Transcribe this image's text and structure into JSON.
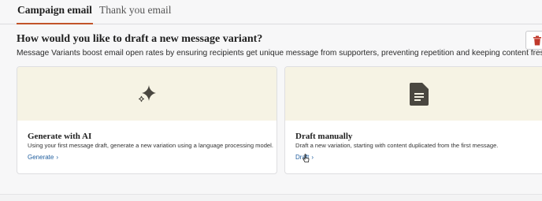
{
  "tabs": [
    {
      "label": "Campaign email",
      "active": true
    },
    {
      "label": "Thank you email",
      "active": false
    }
  ],
  "prompt": {
    "heading": "How would you like to draft a new message variant?",
    "description": "Message Variants boost email open rates by ensuring recipients get unique message from supporters, preventing repetition and keeping content fresh."
  },
  "toolbar": {
    "delete_icon": "trash-icon"
  },
  "options": [
    {
      "icon": "sparkle-icon",
      "title": "Generate with AI",
      "description": "Using your first message draft, generate a new variation using a language processing model.",
      "link": "Generate"
    },
    {
      "icon": "document-icon",
      "title": "Draft manually",
      "description": "Draft a new variation, starting with content duplicated from the first message.",
      "link": "Draft"
    }
  ],
  "colors": {
    "accent": "#c2542a",
    "link": "#1f5d9e",
    "delete": "#c0392b",
    "hero_bg": "#f6f3e4",
    "icon": "#4a4740"
  }
}
